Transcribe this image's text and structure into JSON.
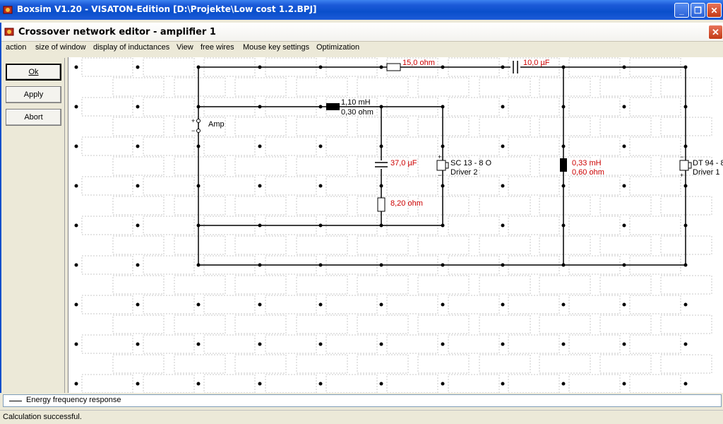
{
  "app": {
    "title": "Boxsim V1.20 - VISATON-Edition [D:\\Projekte\\Low cost 1.2.BPJ]",
    "minimize": "_",
    "maximize": "❐",
    "close": "✕"
  },
  "editor": {
    "title": "Crossover network editor - amplifier 1",
    "close": "✕"
  },
  "menu": {
    "items": [
      "action",
      "size of window",
      "display of inductances",
      "View",
      "free wires",
      "Mouse key settings",
      "Optimization"
    ]
  },
  "buttons": {
    "ok": "Ok",
    "apply": "Apply",
    "abort": "Abort"
  },
  "circuit": {
    "amp_label": "Amp",
    "amp_plus": "+",
    "amp_minus": "−",
    "r1": "15,0 ohm",
    "c1": "10,0 µF",
    "l1_value": "1,10 mH",
    "l1_res": "0,30 ohm",
    "c2": "37,0 µF",
    "r2": "8,20 ohm",
    "driver2_model": "SC 13 - 8 O",
    "driver2_name": "Driver 2",
    "l2_value": "0,33 mH",
    "l2_res": "0,60 ohm",
    "driver1_model": "DT 94 - 8",
    "driver1_name": "Driver 1",
    "plus": "+",
    "minus": "−"
  },
  "colors": {
    "red_value": "#cc0000"
  },
  "legend": {
    "label": "Energy frequency response"
  },
  "status": {
    "text": "Calculation successful."
  }
}
